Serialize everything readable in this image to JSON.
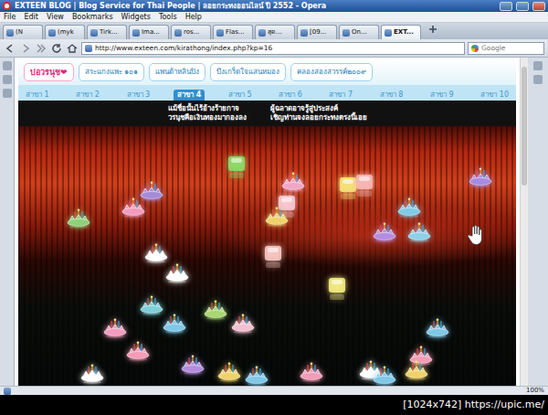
{
  "window": {
    "title": "EXTEEN BLOG | Blog Service for Thai People | ลอยกระทงออนไลน์ ปี 2552 - Opera"
  },
  "menu": [
    "File",
    "Edit",
    "View",
    "Bookmarks",
    "Widgets",
    "Tools",
    "Help"
  ],
  "tabs": [
    {
      "label": "(N",
      "selected": false
    },
    {
      "label": "(myk",
      "selected": false
    },
    {
      "label": "Tirk...",
      "selected": false
    },
    {
      "label": "Ima...",
      "selected": false
    },
    {
      "label": "ros...",
      "selected": false
    },
    {
      "label": "Flas...",
      "selected": false
    },
    {
      "label": "สุด...",
      "selected": false
    },
    {
      "label": "[09...",
      "selected": false
    },
    {
      "label": "On...",
      "selected": false
    },
    {
      "label": "EXT...",
      "selected": true
    }
  ],
  "address": {
    "url": "http://www.exteen.com/kirathong/index.php?kp=16",
    "search_placeholder": "Google"
  },
  "page": {
    "nav_buttons": [
      "บ่อวรนุช❤",
      "สระแกงแพะ ๑๐๑",
      "แพนด้าหลินปิง",
      "บึงเกร็ดใจแสนหมอง",
      "คลองสองสวรรค์๒๐๐๙"
    ],
    "branches": [
      {
        "label": "สาขา 1",
        "selected": false
      },
      {
        "label": "สาขา 2",
        "selected": false
      },
      {
        "label": "สาขา 3",
        "selected": false
      },
      {
        "label": "สาขา 4",
        "selected": true
      },
      {
        "label": "สาขา 5",
        "selected": false
      },
      {
        "label": "สาขา 6",
        "selected": false
      },
      {
        "label": "สาขา 7",
        "selected": false
      },
      {
        "label": "สาขา 8",
        "selected": false
      },
      {
        "label": "สาขา 9",
        "selected": false
      },
      {
        "label": "สาขา 10",
        "selected": false
      }
    ],
    "banner": {
      "left": [
        "แม้ชื่อนั้นไร้อ้างร้ายกาจ",
        "วรนุชคือเงินทองมากองลง"
      ],
      "right": [
        "ผู้ฉลาดอาจรู้สู่ประสงค์",
        "เชิญท่านจงลอยกระทงตรงนี้เอย"
      ]
    },
    "krathongs": [
      {
        "kind": "lotus",
        "color": "#a58cd8"
      },
      {
        "kind": "lantern",
        "color": "#8fd86a"
      },
      {
        "kind": "lotus",
        "color": "#f1a6c6"
      },
      {
        "kind": "lantern",
        "color": "#f4e27a"
      },
      {
        "kind": "lantern",
        "color": "#f6b7b4"
      },
      {
        "kind": "lotus",
        "color": "#a78be0"
      },
      {
        "kind": "lotus",
        "color": "#8ed07a"
      },
      {
        "kind": "lotus",
        "color": "#f29cc0"
      },
      {
        "kind": "lantern",
        "color": "#f7c8d0"
      },
      {
        "kind": "lotus",
        "color": "#f0d26a"
      },
      {
        "kind": "lotus",
        "color": "#7ecbe8"
      },
      {
        "kind": "lotus",
        "color": "#b58de0"
      },
      {
        "kind": "lotus",
        "color": "#8fd0e8"
      },
      {
        "kind": "lotus",
        "color": "#ffffff"
      },
      {
        "kind": "lotus",
        "color": "#ffffff"
      },
      {
        "kind": "lantern",
        "color": "#f6c6c0"
      },
      {
        "kind": "lantern",
        "color": "#f2ea80"
      },
      {
        "kind": "lotus",
        "color": "#7fd0d8"
      },
      {
        "kind": "lotus",
        "color": "#a8d870"
      },
      {
        "kind": "lotus",
        "color": "#f2c0d0"
      },
      {
        "kind": "lotus",
        "color": "#f29cc0"
      },
      {
        "kind": "lotus",
        "color": "#7fc8e8"
      },
      {
        "kind": "lotus",
        "color": "#f39cb8"
      },
      {
        "kind": "lotus",
        "color": "#b58de0"
      },
      {
        "kind": "lotus",
        "color": "#f0d26a"
      },
      {
        "kind": "lotus",
        "color": "#7fc8e8"
      },
      {
        "kind": "lotus",
        "color": "#f39cb8"
      },
      {
        "kind": "lotus",
        "color": "#ffffff"
      },
      {
        "kind": "lotus",
        "color": "#7fc8e8"
      },
      {
        "kind": "lotus",
        "color": "#f39cb8"
      },
      {
        "kind": "lotus",
        "color": "#7fc8e8"
      },
      {
        "kind": "lotus",
        "color": "#ffffff"
      },
      {
        "kind": "lotus",
        "color": "#f0d26a"
      }
    ]
  },
  "status_bar": {
    "zoom": "100%"
  },
  "footer": {
    "caption": "[1024x742] https://upic.me/"
  }
}
